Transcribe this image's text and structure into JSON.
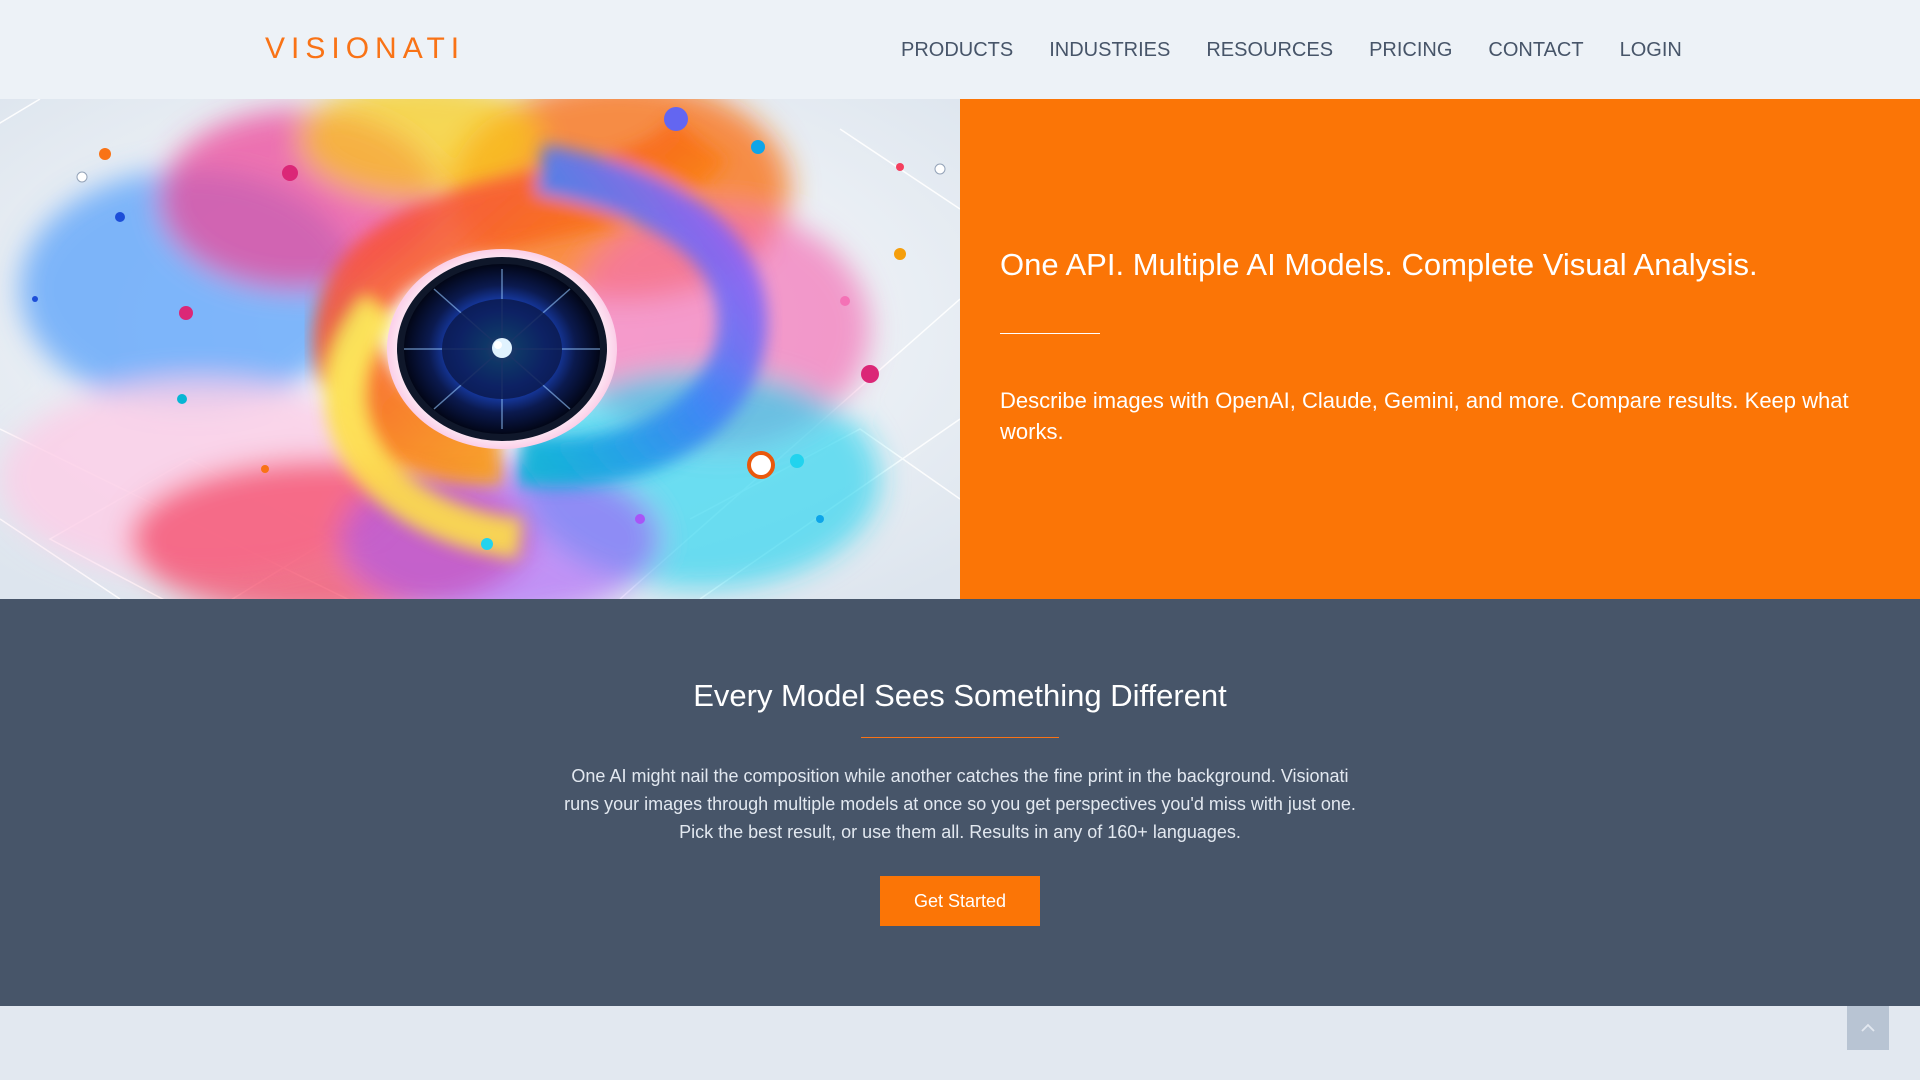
{
  "brand": {
    "name": "VISIONATI",
    "accent": "#f97316"
  },
  "nav": {
    "items": [
      "PRODUCTS",
      "INDUSTRIES",
      "RESOURCES",
      "PRICING",
      "CONTACT",
      "LOGIN"
    ]
  },
  "hero": {
    "image_alt_name": "ai-eye-artwork",
    "title": "One API. Multiple AI Models. Complete Visual Analysis.",
    "description": "Describe images with OpenAI, Claude, Gemini, and more. Compare results. Keep what works.",
    "panel_color": "#fb7506"
  },
  "feature": {
    "title": "Every Model Sees Something Different",
    "body": "One AI might nail the composition while another catches the fine print in the background. Visionati runs your images through multiple models at once so you get perspectives you'd miss with just one. Pick the best result, or use them all. Results in any of 160+ languages.",
    "cta_label": "Get Started",
    "background": "#475569"
  },
  "scroll_top": {
    "icon": "chevron-up-icon"
  }
}
